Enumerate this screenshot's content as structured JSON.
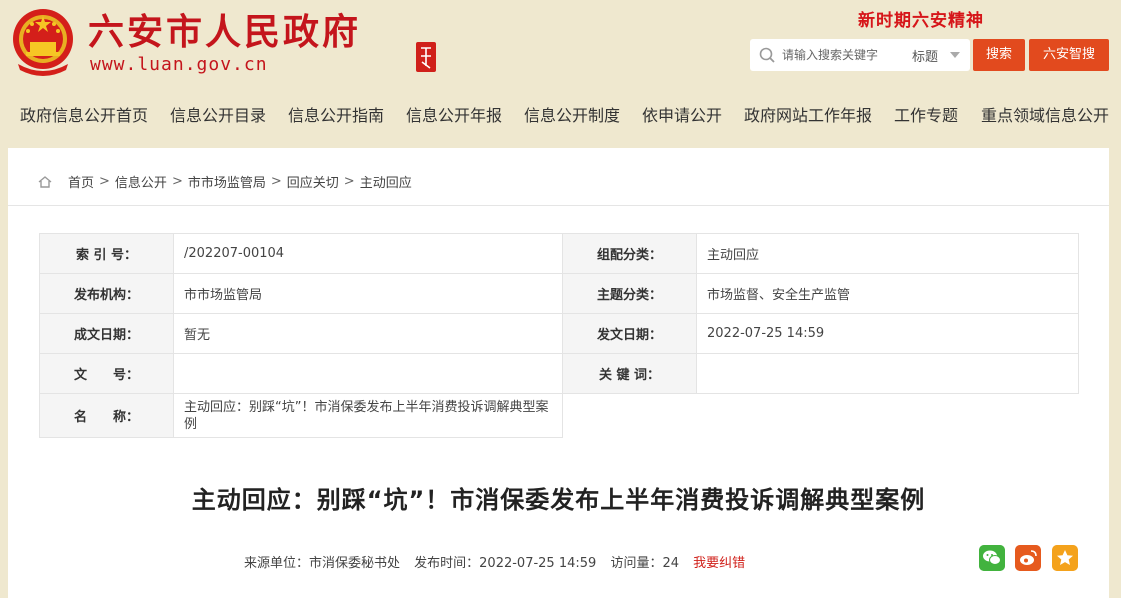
{
  "header": {
    "title": "六安市人民政府",
    "url": "www.luan.gov.cn",
    "seal_text": "六安市",
    "slogan": "新时期六安精神",
    "search": {
      "placeholder": "请输入搜索关键字",
      "scope": "标题",
      "search_button": "搜索",
      "smart_button": "六安智搜"
    }
  },
  "nav": [
    "政府信息公开首页",
    "信息公开目录",
    "信息公开指南",
    "信息公开年报",
    "信息公开制度",
    "依申请公开",
    "政府网站工作年报",
    "工作专题",
    "重点领域信息公开"
  ],
  "breadcrumb": [
    "首页",
    "信息公开",
    "市市场监管局",
    "回应关切",
    "主动回应"
  ],
  "info": {
    "index_label": "索 引 号：",
    "index_value": "/202207-00104",
    "category_label": "组配分类：",
    "category_value": "主动回应",
    "publisher_label": "发布机构：",
    "publisher_value": "市市场监管局",
    "topic_label": "主题分类：",
    "topic_value": "市场监督、安全生产监管",
    "doc_date_label": "成文日期：",
    "doc_date_value": "暂无",
    "pub_date_label": "发文日期：",
    "pub_date_value": "2022-07-25 14:59",
    "doc_no_label": "文　　号：",
    "doc_no_value": "",
    "keywords_label": "关 键 词：",
    "keywords_value": "",
    "name_label": "名　　称：",
    "name_value": "主动回应：别踩“坑”！市消保委发布上半年消费投诉调解典型案例"
  },
  "article": {
    "title": "主动回应：别踩“坑”！市消保委发布上半年消费投诉调解典型案例",
    "source": "来源单位：市消保委秘书处",
    "time": "发布时间：2022-07-25 14:59",
    "views": "访问量：24",
    "report_error": "我要纠错"
  },
  "share_icons": [
    "wechat-icon",
    "weibo-icon",
    "favorite-icon"
  ],
  "colors": {
    "brand_red": "#c4151c",
    "button_orange": "#e24a1e",
    "background": "#efe8cf"
  }
}
